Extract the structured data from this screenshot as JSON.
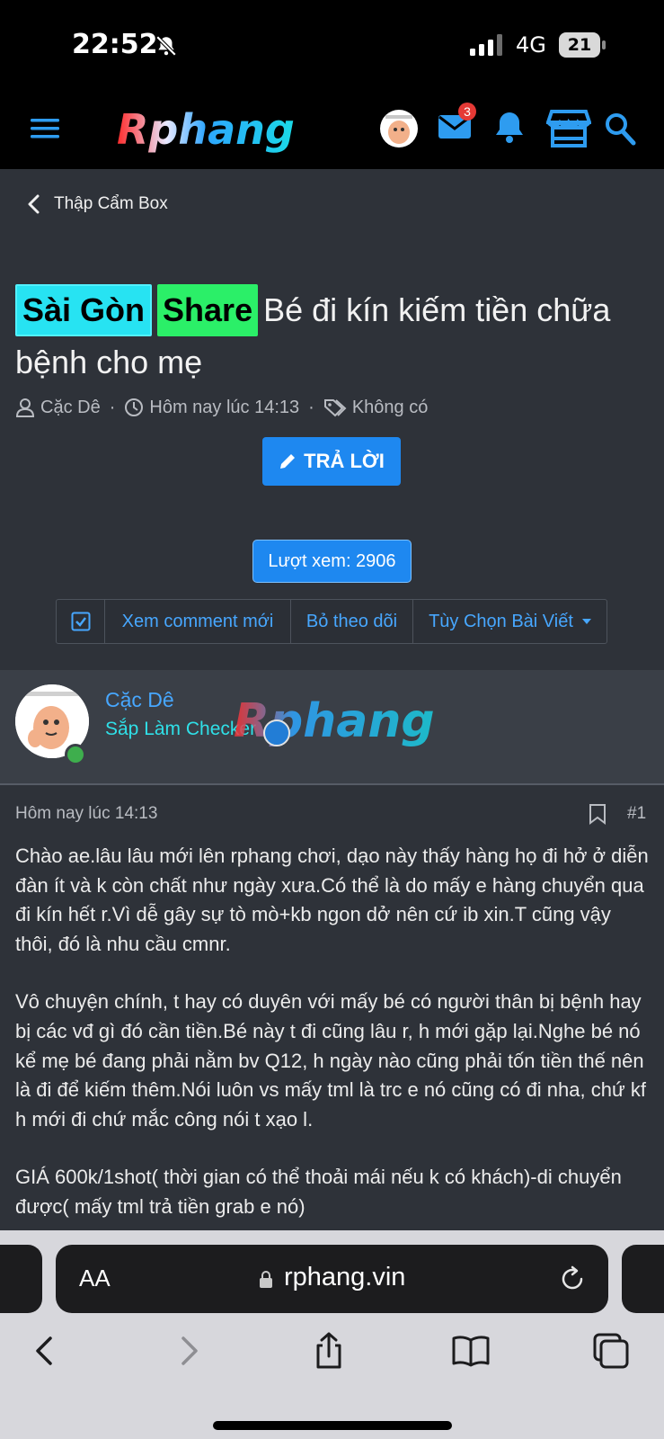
{
  "status_bar": {
    "time": "22:52",
    "network": "4G",
    "battery": "21"
  },
  "header": {
    "logo": "Rphang",
    "mail_badge": "3"
  },
  "breadcrumb": {
    "label": "Thập Cẩm Box"
  },
  "thread": {
    "tags": [
      "Sài Gòn",
      "Share"
    ],
    "title": "Bé đi kín kiếm tiền chữa bệnh cho mẹ",
    "author": "Cặc Dê",
    "date": "Hôm nay lúc 14:13",
    "tags_text": "Không có",
    "reply_label": "TRẢ LỜI",
    "views_label": "Lượt xem: 2906"
  },
  "toolbar": {
    "new_comments": "Xem comment mới",
    "unfollow": "Bỏ theo dõi",
    "options": "Tùy Chọn Bài Viết"
  },
  "post": {
    "author": "Cặc Dê",
    "role": "Sắp Làm Checker",
    "watermark": "Rphang",
    "date": "Hôm nay lúc 14:13",
    "number": "#1",
    "paragraphs": [
      "Chào ae.lâu lâu mới lên rphang chơi, dạo này thấy hàng họ đi hở ở diễn đàn ít và k còn chất như ngày xưa.Có thể là do mấy e hàng chuyển qua đi kín hết r.Vì dễ gây sự tò mò+kb ngon dở nên cứ ib xin.T cũng vậy thôi, đó là nhu cầu cmnr.",
      "Vô chuyện chính, t hay có duyên với mấy bé có người thân bị bệnh hay bị các vđ gì đó cần tiền.Bé này t đi cũng lâu r, h mới gặp lại.Nghe bé nó kể mẹ bé đang phải nằm bv Q12, h ngày nào cũng phải tốn tiền thế nên là đi để kiếm thêm.Nói luôn vs mấy tml là trc e nó cũng có đi nha, chứ kf h mới đi chứ mắc công nói t xạo l.",
      "GIÁ 600k/1shot( thời gian có thể thoải mái nếu k có khách)-di chuyển được( mấy tml trả tiền grab e nó)"
    ]
  },
  "browser": {
    "aa_label": "AA",
    "url": "rphang.vin"
  }
}
